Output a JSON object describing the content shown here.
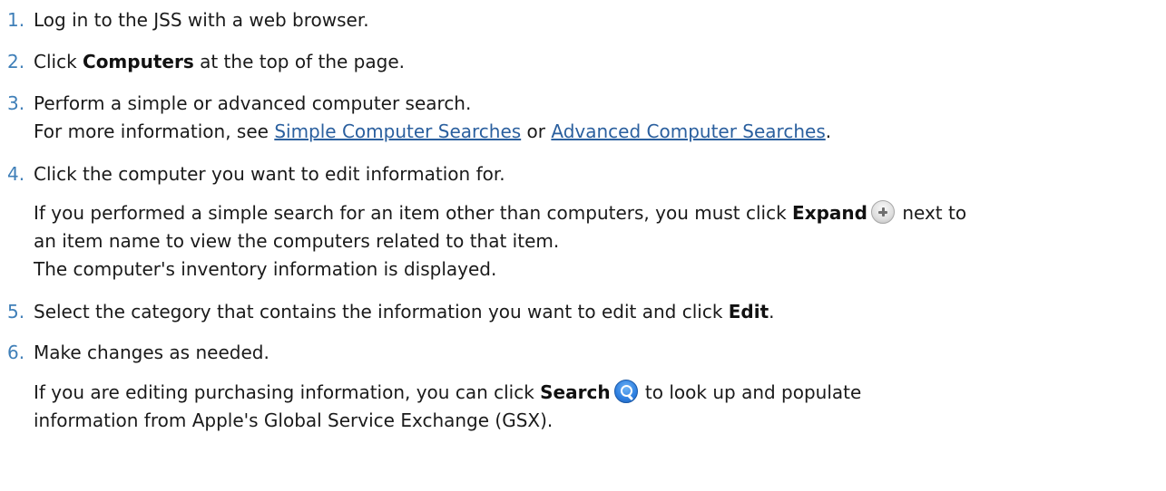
{
  "steps": [
    {
      "num": "1.",
      "text": "Log in to the JSS with a web browser."
    },
    {
      "num": "2.",
      "pre": "Click ",
      "bold": "Computers",
      "post": " at the top of the page."
    },
    {
      "num": "3.",
      "line1": "Perform a simple or advanced computer search.",
      "line2_pre": "For more information, see ",
      "link1": "Simple Computer Searches",
      "line2_mid": " or ",
      "link2": "Advanced Computer Searches",
      "line2_post": "."
    },
    {
      "num": "4.",
      "line1": "Click the computer you want to edit information for.",
      "line2_pre": "If you performed a simple search for an item other than computers, you must click ",
      "bold": "Expand",
      "line2_post": " next to",
      "line3": "an item name to view the computers related to that item.",
      "line4": "The computer's inventory information is displayed."
    },
    {
      "num": "5.",
      "pre": "Select the category that contains the information you want to edit and click ",
      "bold": "Edit",
      "post": "."
    },
    {
      "num": "6.",
      "line1": "Make changes as needed.",
      "line2_pre": "If you are editing purchasing information, you can click ",
      "bold": "Search",
      "line2_post": " to look up and populate",
      "line3": "information from Apple's Global Service Exchange (GSX)."
    }
  ],
  "icons": {
    "expand": "plus-circle-icon",
    "search": "magnifier-icon"
  },
  "colors": {
    "step_number": "#3f7fb8",
    "link": "#2a5f9e",
    "text": "#1a1a1a"
  }
}
